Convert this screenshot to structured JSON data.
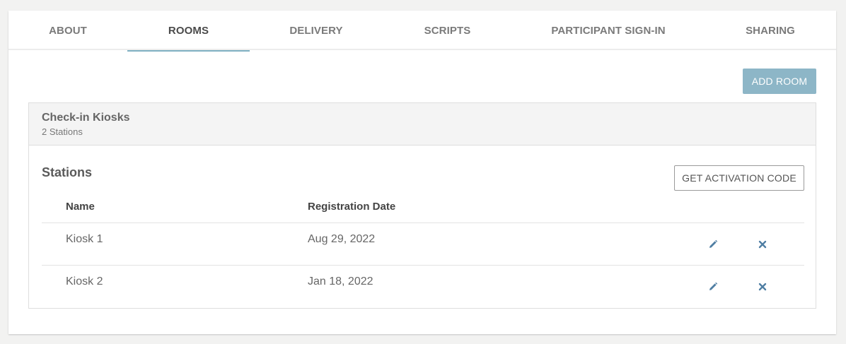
{
  "tabs": [
    {
      "label": "ABOUT"
    },
    {
      "label": "ROOMS"
    },
    {
      "label": "DELIVERY"
    },
    {
      "label": "SCRIPTS"
    },
    {
      "label": "PARTICIPANT SIGN-IN"
    },
    {
      "label": "SHARING"
    }
  ],
  "active_tab": "ROOMS",
  "add_room_label": "ADD ROOM",
  "room": {
    "title": "Check-in Kiosks",
    "subtitle": "2 Stations",
    "stations_title": "Stations",
    "activation_label": "GET ACTIVATION CODE",
    "columns": [
      "Name",
      "Registration Date"
    ],
    "rows": [
      {
        "name": "Kiosk 1",
        "date": "Aug 29, 2022",
        "edit_icon": "pencil-icon",
        "delete_icon": "close-icon"
      },
      {
        "name": "Kiosk 2",
        "date": "Jan 18, 2022",
        "edit_icon": "pencil-icon",
        "delete_icon": "close-icon"
      }
    ]
  },
  "colors": {
    "accent": "#7fb0c2",
    "button_primary": "#8db6c7",
    "icon": "#4f7ea3",
    "background": "#f2f2f1"
  }
}
